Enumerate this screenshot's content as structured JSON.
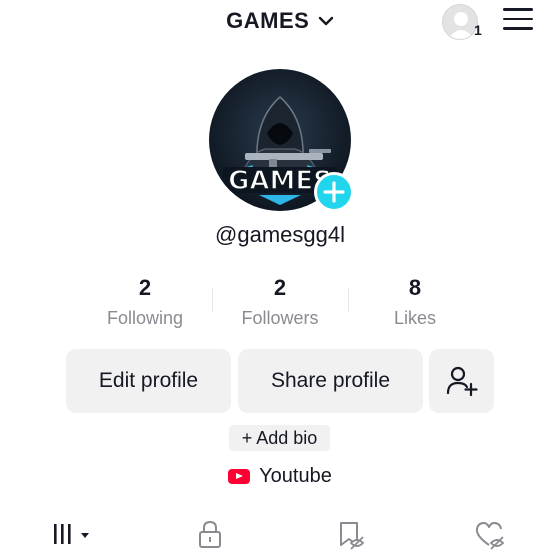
{
  "header": {
    "title": "GAMES",
    "account_count": "1"
  },
  "profile": {
    "username": "@gamesgg4l",
    "avatar_text": "GAMES"
  },
  "stats": [
    {
      "value": "2",
      "label": "Following"
    },
    {
      "value": "2",
      "label": "Followers"
    },
    {
      "value": "8",
      "label": "Likes"
    }
  ],
  "actions": {
    "edit_label": "Edit profile",
    "share_label": "Share profile"
  },
  "bio": {
    "add_label": "+ Add bio"
  },
  "links": {
    "youtube_label": "Youtube"
  },
  "tabs": [
    {
      "icon": "grid-icon"
    },
    {
      "icon": "lock-icon"
    },
    {
      "icon": "bookmark-hidden-icon"
    },
    {
      "icon": "liked-hidden-icon"
    }
  ],
  "colors": {
    "accent": "#20d5ec",
    "youtube": "#ff0033",
    "button_bg": "#f1f1f2",
    "muted_text": "#8a8b91"
  }
}
